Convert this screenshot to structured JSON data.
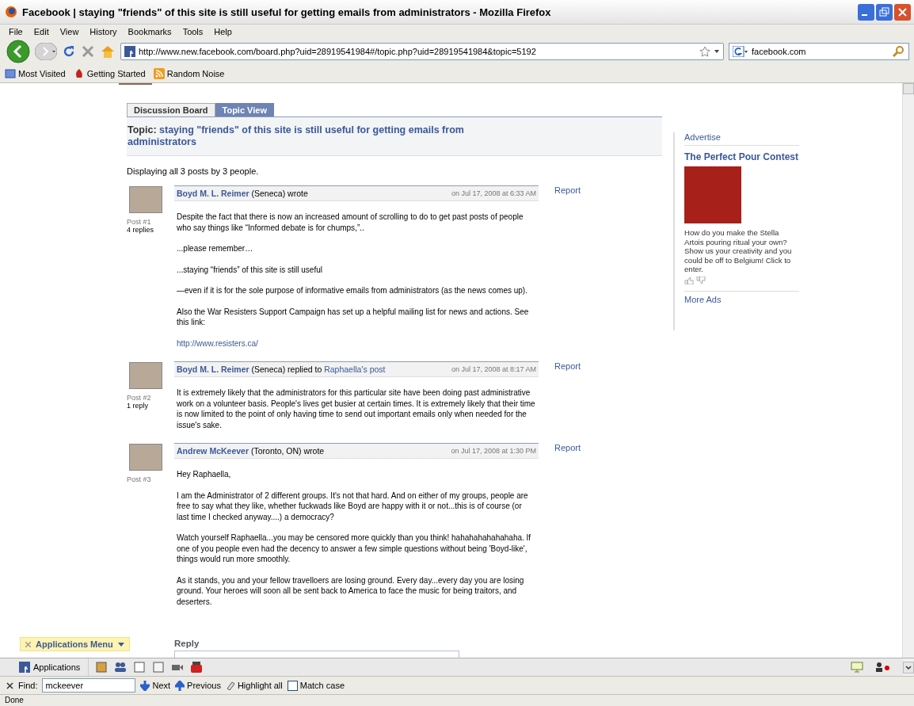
{
  "window": {
    "title": "Facebook | staying \"friends\" of this site is still useful for getting emails from administrators - Mozilla Firefox"
  },
  "menu": [
    "File",
    "Edit",
    "View",
    "History",
    "Bookmarks",
    "Tools",
    "Help"
  ],
  "address": {
    "value": "http://www.new.facebook.com/board.php?uid=28919541984#/topic.php?uid=28919541984&topic=5192"
  },
  "search": {
    "value": "facebook.com"
  },
  "bookmarks": [
    {
      "label": "Most Visited",
      "kind": "places"
    },
    {
      "label": "Getting Started",
      "kind": "start"
    },
    {
      "label": "Random Noise",
      "kind": "feed"
    }
  ],
  "tabs": [
    {
      "label": "Discussion Board",
      "selected": false
    },
    {
      "label": "Topic View",
      "selected": true
    }
  ],
  "topic": {
    "label": "Topic:",
    "title": "staying \"friends\" of this site is still useful for getting emails from administrators"
  },
  "summary": "Displaying all 3 posts by 3 people.",
  "posts": [
    {
      "number": "Post #1",
      "replies": "4 replies",
      "author": "Boyd M. L. Reimer",
      "action": "(Seneca) wrote",
      "date": "on Jul 17, 2008 at 6:33 AM",
      "report": "Report",
      "paragraphs": [
        {
          "kind": "text",
          "text": "Despite the fact that there is now an increased amount of scrolling to do to get past posts of people who say things like “Informed debate is for chumps,”.."
        },
        {
          "kind": "text",
          "text": "...please remember…"
        },
        {
          "kind": "text",
          "text": "...staying “friends” of this site is still useful"
        },
        {
          "kind": "text",
          "text": "—even if it is for the sole purpose of informative emails from administrators (as the news comes up)."
        },
        {
          "kind": "text",
          "text": "Also the War Resisters Support Campaign has set up a helpful mailing list for news and actions. See this link:"
        },
        {
          "kind": "link",
          "text": "http://www.resisters.ca/"
        }
      ]
    },
    {
      "number": "Post #2",
      "replies": "1 reply",
      "author": "Boyd M. L. Reimer",
      "action": "(Seneca) replied to",
      "reply_to": "Raphaella's post",
      "date": "on Jul 17, 2008 at 8:17 AM",
      "report": "Report",
      "paragraphs": [
        {
          "kind": "text",
          "text": "It is extremely likely that the administrators for this particular site have been doing past administrative work on a volunteer basis. People's lives get busier at certain times. It is extremely likely that their time is now limited to the point of only having time to send out important emails only when needed for the issue's sake."
        }
      ]
    },
    {
      "number": "Post #3",
      "author": "Andrew McKeever",
      "action": "(Toronto, ON) wrote",
      "date": "on Jul 17, 2008 at 1:30 PM",
      "report": "Report",
      "paragraphs": [
        {
          "kind": "text",
          "text": "Hey Raphaella,"
        },
        {
          "kind": "text",
          "text": "I am the Administrator of 2 different groups. It's not that hard. And on either of my groups, people are free to say what they like, whether fuckwads like Boyd are happy with it or not...this is of course (or last time I checked anyway....) a democracy?"
        },
        {
          "kind": "text",
          "text": "Watch yourself Raphaella...you may be censored more quickly than you think! hahahahahahahaha. If one of you people even had the decency to answer a few simple questions without being 'Boyd-like', things would run more smoothly."
        },
        {
          "kind": "text",
          "text": "As it stands, you and your fellow travelloers are losing ground. Every day...every day you are losing ground. Your heroes will soon all be sent back to America to face the music for being traitors, and deserters."
        }
      ]
    }
  ],
  "reply": {
    "label": "Reply"
  },
  "ads": {
    "advertise": "Advertise",
    "title": "The Perfect Pour Contest",
    "body": "How do you make the Stella Artois pouring ritual your own? Show us your creativity and you could be off to Belgium! Click to enter.",
    "more": "More Ads"
  },
  "applications_menu": "Applications Menu",
  "app_bar": {
    "applications": "Applications"
  },
  "find": {
    "label": "Find:",
    "value": "mckeever",
    "next": "Next",
    "previous": "Previous",
    "highlight": "Highlight all",
    "match_case": {
      "label": "Match case",
      "checked": false
    }
  },
  "status": "Done"
}
